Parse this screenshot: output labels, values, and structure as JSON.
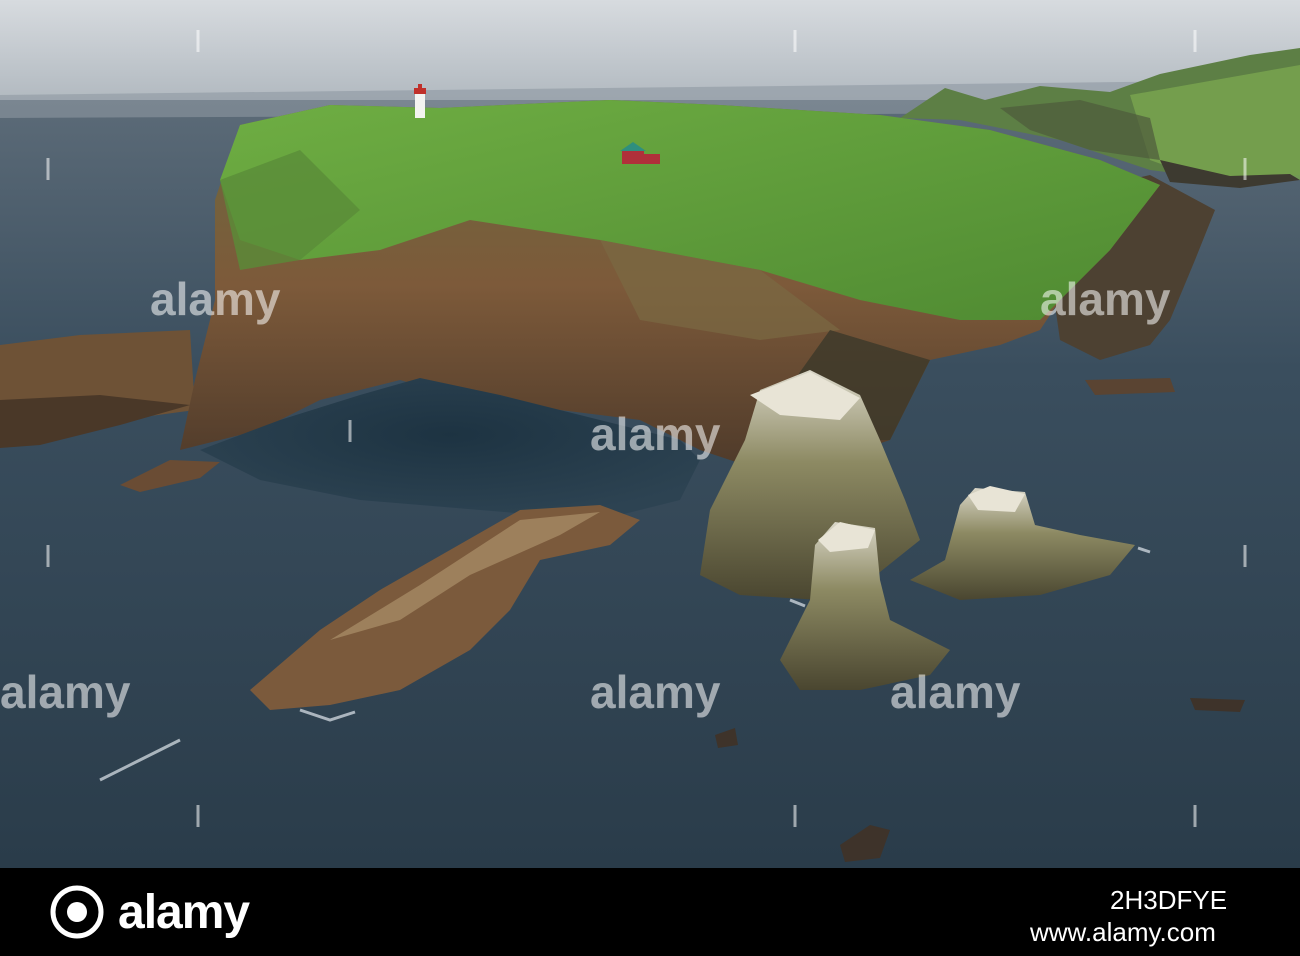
{
  "photo": {
    "subject": "coastal-cliff-headland-with-lighthouse",
    "colors": {
      "sea": "#2b3f4e",
      "sky": "#c9cfd4",
      "grass": "#5f9a3a",
      "rock": "#7a5a3c"
    }
  },
  "watermark": {
    "text": "alamy",
    "icon": "alamy-logo-icon"
  },
  "footer": {
    "logo_text": "alamy",
    "logo_icon": "alamy-logo-icon",
    "image_id": "2H3DFYE",
    "url": "www.alamy.com"
  }
}
